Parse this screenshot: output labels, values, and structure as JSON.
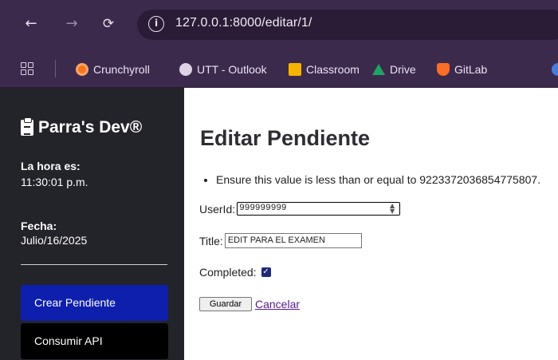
{
  "browser": {
    "url": "127.0.0.1:8000/editar/1/",
    "bookmarks": [
      {
        "label": "Crunchyroll",
        "icon": "crunchyroll-icon"
      },
      {
        "label": "UTT - Outlook",
        "icon": "outlook-globe-icon"
      },
      {
        "label": "Classroom",
        "icon": "classroom-icon"
      },
      {
        "label": "Drive",
        "icon": "drive-icon"
      },
      {
        "label": "GitLab",
        "icon": "gitlab-icon"
      }
    ]
  },
  "sidebar": {
    "brand": "Parra's Dev®",
    "time_label": "La hora es:",
    "time_value": "11:30:01 p.m.",
    "date_label": "Fecha:",
    "date_value": "Julio/16/2025",
    "buttons": [
      {
        "label": "Crear Pendiente"
      },
      {
        "label": "Consumir API"
      }
    ]
  },
  "main": {
    "title": "Editar Pendiente",
    "error": "Ensure this value is less than or equal to 9223372036854775807.",
    "userid_label": "UserId:",
    "userid_value": "999999999",
    "title_label": "Title:",
    "title_value": "EDIT PARA EL EXAMEN",
    "completed_label": "Completed:",
    "completed_checked": true,
    "save_label": "Guardar",
    "cancel_label": "Cancelar"
  },
  "colors": {
    "chrome": "#3c2a4d",
    "sidebar": "#23232a",
    "primary_button": "#0e1fae",
    "secondary_button": "#000000",
    "link": "#551a8b"
  }
}
